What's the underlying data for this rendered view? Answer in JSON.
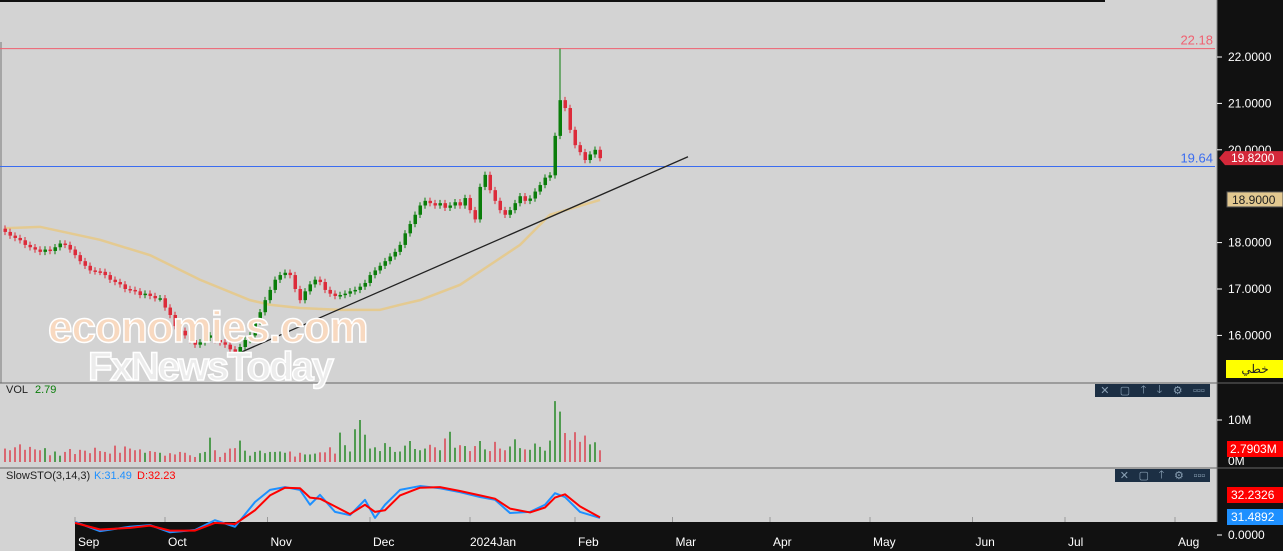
{
  "colors": {
    "up": "#0a7d0a",
    "down": "#dc2b3a",
    "ma": "#e6c98a",
    "resistance": "#f06070",
    "support": "#3a6cf0",
    "k": "#1e90ff",
    "d": "#ff0000",
    "axis_bg": "#111111"
  },
  "watermark": {
    "line1": "economies.com",
    "line2": "FxNewsToday"
  },
  "panels": {
    "volume": {
      "label": "VOL",
      "value": "2.79"
    },
    "stoch": {
      "label": "SlowSTO(3,14,3)",
      "k_label": "K:31.49",
      "d_label": "D:32.23"
    }
  },
  "panel_toolbar": {
    "icons": [
      "close-icon",
      "maximize-icon",
      "move-up-icon",
      "move-down-icon",
      "settings-icon",
      "more-icon"
    ],
    "glyphs": [
      "✕",
      "▢",
      "🡑",
      "🡓",
      "⚙",
      "▫▫▫"
    ]
  },
  "axis": {
    "price_ticks": [
      "22.0000",
      "21.0000",
      "20.0000",
      "18.0000",
      "17.0000",
      "16.0000"
    ],
    "price_tick_values": [
      22,
      21,
      20,
      18,
      17,
      16
    ],
    "last_price_tag": "19.8200",
    "ma_tag": "18.9000",
    "line_type_tag": "خطي",
    "volume_ticks": [
      "10M",
      "0M"
    ],
    "volume_tag": "2.7903M",
    "stoch_d_tag": "32.2326",
    "stoch_k_tag": "31.4892",
    "stoch_zero": "0.0000"
  },
  "chart_data": {
    "type": "candlestick",
    "months": [
      "Sep",
      "Oct",
      "Nov",
      "Dec",
      "2024Jan",
      "Feb",
      "Mar",
      "Apr",
      "May",
      "Jun",
      "Jul",
      "Aug"
    ],
    "month_bar_index": [
      14,
      32,
      52.5,
      73,
      93,
      114,
      133.5,
      153,
      173,
      193.5,
      212,
      234
    ],
    "start_open": 18.3,
    "closes": [
      18.23,
      18.15,
      18.1,
      18.05,
      17.95,
      17.9,
      17.85,
      17.8,
      17.85,
      17.82,
      17.9,
      17.98,
      17.95,
      17.85,
      17.73,
      17.6,
      17.5,
      17.4,
      17.38,
      17.37,
      17.3,
      17.2,
      17.15,
      17.1,
      17.0,
      16.98,
      16.95,
      16.87,
      16.9,
      16.85,
      16.8,
      16.8,
      16.6,
      16.44,
      16.2,
      16.1,
      16.0,
      15.9,
      15.8,
      15.85,
      15.95,
      16.0,
      15.9,
      15.85,
      15.8,
      15.7,
      15.58,
      15.75,
      15.9,
      16.0,
      16.3,
      16.5,
      16.76,
      16.98,
      17.2,
      17.3,
      17.35,
      17.3,
      17.0,
      16.76,
      16.95,
      17.1,
      17.2,
      17.15,
      16.98,
      16.9,
      16.85,
      16.87,
      16.9,
      16.95,
      16.98,
      17.05,
      17.13,
      17.3,
      17.4,
      17.5,
      17.6,
      17.7,
      17.8,
      17.95,
      18.2,
      18.4,
      18.6,
      18.8,
      18.9,
      18.85,
      18.8,
      18.85,
      18.75,
      18.8,
      18.87,
      18.8,
      18.96,
      18.7,
      18.5,
      19.2,
      19.46,
      19.13,
      18.9,
      18.7,
      18.6,
      18.7,
      18.85,
      19.0,
      18.9,
      18.95,
      19.1,
      19.24,
      19.4,
      19.45,
      20.3,
      21.07,
      20.9,
      20.43,
      20.1,
      19.95,
      19.78,
      19.9,
      20.0,
      19.82
    ],
    "spike_high": {
      "bar": 111,
      "value": 22.18
    },
    "volumes_m": [
      3.2,
      2.8,
      3.5,
      4.2,
      2.9,
      3.6,
      3.0,
      2.8,
      3.3,
      1.6,
      2.5,
      1.5,
      2.4,
      3.1,
      1.9,
      2.9,
      2.7,
      2.1,
      3.4,
      2.6,
      2.4,
      2.0,
      3.9,
      2.2,
      3.7,
      3.2,
      2.8,
      3.0,
      2.2,
      2.6,
      2.4,
      2.2,
      1.5,
      2.1,
      1.8,
      2.4,
      2.2,
      1.6,
      1.2,
      2.1,
      2.4,
      5.8,
      2.8,
      1.2,
      2.2,
      3.2,
      3.3,
      5.1,
      2.7,
      1.5,
      2.4,
      2.7,
      2.1,
      2.4,
      2.4,
      2.5,
      2.2,
      2.5,
      1.3,
      2.2,
      1.8,
      1.8,
      2.0,
      2.3,
      2.3,
      3.5,
      2.0,
      7.0,
      4.0,
      2.5,
      7.8,
      10.0,
      6.5,
      3.2,
      3.5,
      2.6,
      4.5,
      3.6,
      2.4,
      2.5,
      3.9,
      5.0,
      3.1,
      2.8,
      3.2,
      4.1,
      3.5,
      2.8,
      5.6,
      7.2,
      3.4,
      4.0,
      3.8,
      2.6,
      3.8,
      5.0,
      3.0,
      2.6,
      4.8,
      3.2,
      2.8,
      3.7,
      5.4,
      3.3,
      3.0,
      2.9,
      4.4,
      3.6,
      2.7,
      5.1,
      14.5,
      12.0,
      6.9,
      5.2,
      7.1,
      4.8,
      6.3,
      4.2,
      4.7,
      2.79
    ],
    "ma_points": [
      [
        0,
        18.31
      ],
      [
        7,
        18.34
      ],
      [
        19,
        18.06
      ],
      [
        29,
        17.73
      ],
      [
        39,
        17.2
      ],
      [
        49,
        16.76
      ],
      [
        53,
        16.66
      ],
      [
        59,
        16.59
      ],
      [
        67,
        16.55
      ],
      [
        75,
        16.55
      ],
      [
        79,
        16.66
      ],
      [
        83,
        16.76
      ],
      [
        91,
        17.09
      ],
      [
        97,
        17.52
      ],
      [
        103,
        17.95
      ],
      [
        109,
        18.6
      ],
      [
        119,
        18.92
      ]
    ],
    "trendline": [
      [
        46,
        15.58
      ],
      [
        136.6,
        19.85
      ]
    ],
    "resistance": {
      "value": 22.18,
      "label": "22.18"
    },
    "support": {
      "value": 19.64,
      "label": "19.64"
    },
    "stoch_k": [
      [
        14,
        24
      ],
      [
        19,
        7
      ],
      [
        25,
        15
      ],
      [
        29,
        18
      ],
      [
        33,
        5
      ],
      [
        38,
        9
      ],
      [
        42,
        27
      ],
      [
        46,
        15
      ],
      [
        50,
        60
      ],
      [
        53,
        82
      ],
      [
        56,
        87
      ],
      [
        59,
        82
      ],
      [
        61,
        55
      ],
      [
        63,
        73
      ],
      [
        66,
        42
      ],
      [
        69,
        36
      ],
      [
        72,
        64
      ],
      [
        74,
        31
      ],
      [
        76,
        55
      ],
      [
        79,
        82
      ],
      [
        83,
        89
      ],
      [
        87,
        85
      ],
      [
        91,
        78
      ],
      [
        95,
        69
      ],
      [
        98,
        64
      ],
      [
        101,
        40
      ],
      [
        105,
        42
      ],
      [
        108,
        55
      ],
      [
        110,
        76
      ],
      [
        112,
        69
      ],
      [
        115,
        42
      ],
      [
        119,
        31
      ]
    ],
    "stoch_d": [
      [
        14,
        22
      ],
      [
        19,
        10
      ],
      [
        25,
        13
      ],
      [
        29,
        17
      ],
      [
        33,
        8
      ],
      [
        38,
        8
      ],
      [
        42,
        22
      ],
      [
        46,
        20
      ],
      [
        50,
        45
      ],
      [
        53,
        72
      ],
      [
        56,
        86
      ],
      [
        59,
        85
      ],
      [
        61,
        68
      ],
      [
        63,
        66
      ],
      [
        66,
        52
      ],
      [
        69,
        38
      ],
      [
        72,
        55
      ],
      [
        74,
        42
      ],
      [
        76,
        45
      ],
      [
        79,
        72
      ],
      [
        83,
        86
      ],
      [
        87,
        87
      ],
      [
        91,
        80
      ],
      [
        95,
        72
      ],
      [
        98,
        66
      ],
      [
        101,
        48
      ],
      [
        105,
        41
      ],
      [
        108,
        50
      ],
      [
        110,
        68
      ],
      [
        112,
        74
      ],
      [
        115,
        52
      ],
      [
        119,
        32
      ]
    ],
    "price_range": [
      15,
      22.4
    ],
    "stoch_range": [
      0,
      100
    ]
  }
}
